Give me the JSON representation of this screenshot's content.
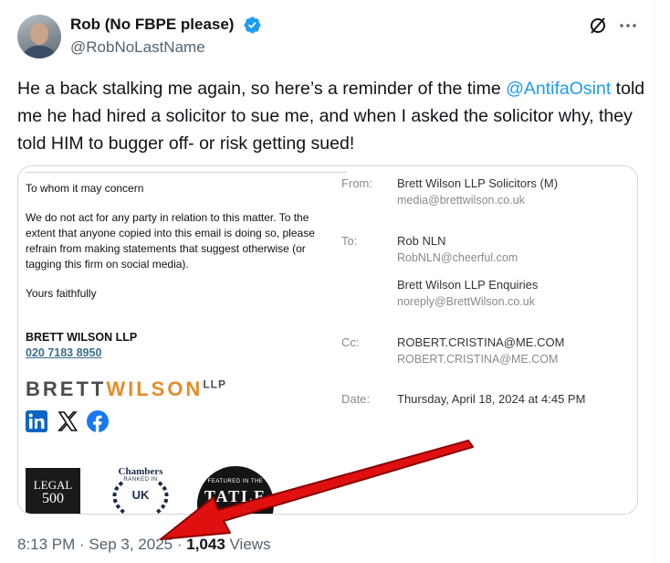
{
  "author": {
    "display_name": "Rob (No FBPE please)",
    "handle": "@RobNoLastName",
    "verified": true,
    "avatar_icon": "profile-avatar"
  },
  "header_actions": {
    "grok_icon": "grok-icon",
    "more_icon": "more-horizontal-icon"
  },
  "tweet": {
    "text_before": "He a back stalking me again, so here’s a reminder of the time ",
    "mention": "@AntifaOsint",
    "text_after": " told me he had hired a solicitor to sue me, and when I asked the solicitor why, they told HIM to bugger off- or risk getting sued!"
  },
  "email": {
    "greeting": "To whom it may concern",
    "body": "We do not act for any party in relation to this matter.  To the extent that anyone copied into this email is doing so, please refrain from making statements that suggest otherwise (or tagging this firm on social media).",
    "closing": "Yours faithfully",
    "signature_name": "BRETT WILSON LLP",
    "signature_phone": "020 7183 8950",
    "logo_part1": "BRETT",
    "logo_part2": "WILSON",
    "logo_part3": "LLP",
    "social_icons": [
      "linkedin-icon",
      "x-icon",
      "facebook-icon"
    ],
    "badges": {
      "legal500_line1": "LEGAL",
      "legal500_line2": "500",
      "chambers_title": "Chambers",
      "chambers_ranked": "RANKED IN",
      "chambers_region": "UK",
      "tatler_line1": "FEATURED IN THE",
      "tatler_line2": "TATLE"
    },
    "headers": {
      "from_label": "From:",
      "from_name": "Brett Wilson LLP Solicitors (M)",
      "from_email": "media@brettwilson.co.uk",
      "to_label": "To:",
      "to_name_1": "Rob NLN",
      "to_email_1": "RobNLN@cheerful.com",
      "to_name_2": "Brett Wilson LLP Enquiries",
      "to_email_2": "noreply@BrettWilson.co.uk",
      "cc_label": "Cc:",
      "cc_name": "ROBERT.CRISTINA@ME.COM",
      "cc_email": "ROBERT.CRISTINA@ME.COM",
      "date_label": "Date:",
      "date_value": "Thursday, April 18, 2024 at 4:45 PM"
    }
  },
  "meta": {
    "time": "8:13 PM",
    "separator": " · ",
    "date": "Sep 3, 2025",
    "separator2": " · ",
    "views_count": "1,043",
    "views_label": " Views"
  },
  "colors": {
    "accent": "#1d9bf0",
    "text_primary": "#0f1419",
    "text_secondary": "#536471",
    "arrow_red": "#e01010"
  }
}
